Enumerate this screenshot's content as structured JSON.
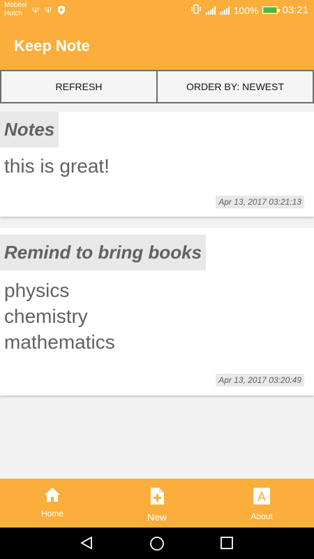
{
  "status_bar": {
    "carrier_line1": "Mobitel",
    "carrier_line2": "Hutch",
    "battery": "100%",
    "time": "03:21"
  },
  "app_bar": {
    "title": "Keep Note"
  },
  "toolbar": {
    "refresh_label": "REFRESH",
    "order_label": "ORDER BY: NEWEST"
  },
  "notes": [
    {
      "title": "Notes",
      "body": "this is great!",
      "timestamp": "Apr 13, 2017 03:21:13"
    },
    {
      "title": "Remind to bring books",
      "body": "physics\nchemistry\nmathematics",
      "timestamp": "Apr 13, 2017 03:20:49"
    }
  ],
  "bottom_nav": {
    "home_label": "Home",
    "new_label": "New",
    "about_label": "About"
  },
  "colors": {
    "accent": "#fbae3c",
    "text_gray": "#616161",
    "battery_green": "#3fbf4a"
  },
  "icons": [
    "usb-icon",
    "shield-icon",
    "vibrate-icon",
    "signal-icon",
    "battery-icon",
    "home-icon",
    "new-note-icon",
    "about-icon",
    "back-icon",
    "home-circle-icon",
    "recents-icon"
  ]
}
